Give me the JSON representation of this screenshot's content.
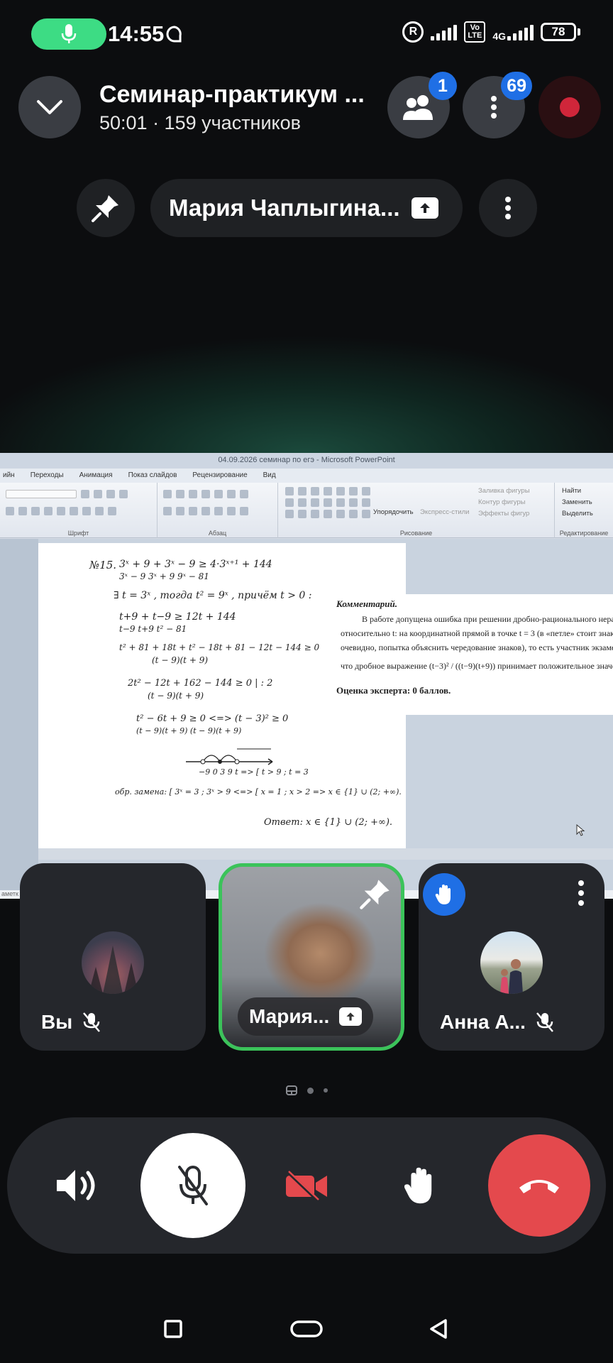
{
  "status_bar": {
    "time": "14:55",
    "volte_top": "Vo",
    "volte_bottom": "LTE",
    "network": "4G",
    "battery": "78",
    "icons": [
      "mic-active-icon",
      "chat-bubble-icon",
      "registered-icon",
      "signal-icon",
      "battery-icon"
    ]
  },
  "call": {
    "title": "Семинар-практикум ...",
    "subtitle": "50:01 · 159 участников",
    "participants_badge": "1",
    "more_badge": "69",
    "record_color": "#d0263a"
  },
  "pinned": {
    "speaker_name": "Мария Чаплыгина..."
  },
  "shared_screen": {
    "window_title": "04.09.2026 семинар по егэ - Microsoft PowerPoint",
    "ribbon_tabs": [
      "ийн",
      "Переходы",
      "Анимация",
      "Показ слайдов",
      "Рецензирование",
      "Вид"
    ],
    "ribbon_groups": [
      "Шрифт",
      "Абзац",
      "Рисование",
      "Редактирование"
    ],
    "ribbon_items": {
      "arrange": "Упорядочить",
      "express_styles": "Экспресс-стили",
      "shape_fill": "Заливка фигуры",
      "shape_outline": "Контур фигуры",
      "shape_effects": "Эффекты фигур",
      "find": "Найти",
      "replace": "Заменить",
      "select": "Выделить"
    },
    "math": {
      "task": "№15.",
      "line1": "3ˣ + 9   +   3ˣ − 9   ≥   4·3ˣ⁺¹ + 144",
      "line1b": "3ˣ − 9        3ˣ + 9          9ˣ − 81",
      "line2": "∃ t = 3ˣ ,  тогда  t² = 9ˣ ,  причём  t > 0 :",
      "line3": "t+9  +  t−9  ≥  12t + 144",
      "line3b": "t−9      t+9        t² − 81",
      "line4": "t² + 81 + 18t + t² − 18t + 81 − 12t − 144   ≥ 0",
      "line4b": "(t − 9)(t + 9)",
      "line5": "2t² − 12t + 162 − 144   ≥ 0   | : 2",
      "line5b": "(t − 9)(t + 9)",
      "line6": "t² − 6t + 9  ≥ 0   <=>   (t − 3)²   ≥ 0",
      "line6b": "(t − 9)(t + 9)                 (t − 9)(t + 9)",
      "axis": "−9  0   3    9        t   =>  [ t > 9 ;  t = 3",
      "line7": "обр. замена:  [ 3ˣ = 3 ; 3ˣ > 9   <=>  [ x = 1 ; x > 2   =>  x ∈ {1} ∪ (2; +∞).",
      "answer": "Ответ:  x ∈ {1} ∪ (2; +∞)."
    },
    "comment": {
      "title": "Комментарий.",
      "line1": "В работе допущена ошибка при решении дробно-рационального неравенс",
      "line2": "относительно t: на координатной прямой в точке t = 3 (в «петле» стоит знак «+»",
      "line3": "очевидно, попытка объяснить чередование знаков), то есть участник экзамена утвержд",
      "line4": "что дробное выражение  (t−3)² / ((t−9)(t+9))  принимает положительное значение.",
      "score": "Оценка эксперта: 0 баллов."
    },
    "notes": "аметк"
  },
  "tiles": {
    "you": {
      "name": "Вы"
    },
    "maria": {
      "name": "Мария..."
    },
    "anna": {
      "name": "Анна А..."
    }
  },
  "controls": {
    "icons": [
      "speaker-icon",
      "mic-off-icon",
      "camera-off-icon",
      "raise-hand-icon",
      "end-call-icon"
    ],
    "end_color": "#e4494d"
  },
  "navigation": {
    "icons": [
      "recent-apps-icon",
      "home-icon",
      "back-icon"
    ]
  }
}
